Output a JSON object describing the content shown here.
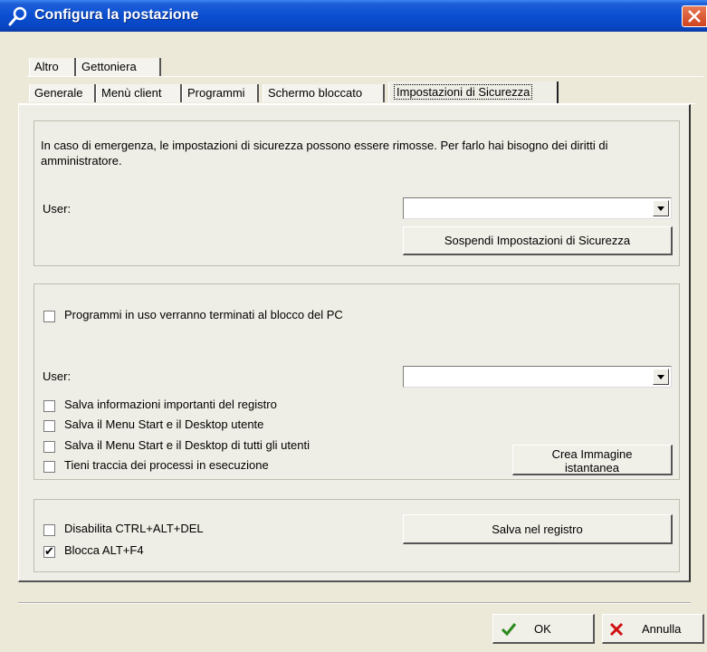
{
  "window": {
    "title": "Configura la postazione",
    "icon": "wrench-icon"
  },
  "tabs": {
    "row1": [
      "Altro",
      "Gettoniera"
    ],
    "row2": [
      "Generale",
      "Menù client",
      "Programmi",
      "Schermo bloccato",
      "Impostazioni di Sicurezza"
    ],
    "active": "Impostazioni di Sicurezza"
  },
  "emergency": {
    "description": "In caso di emergenza, le impostazioni di sicurezza possono essere rimosse. Per farlo hai bisogno dei diritti di amministratore.",
    "user_label": "User:",
    "user_value": "",
    "suspend_button": "Sospendi Impostazioni di Sicurezza"
  },
  "lock": {
    "terminate_label": "Programmi in uso verranno terminati al blocco del PC",
    "terminate_checked": false,
    "user_label": "User:",
    "user_value": "",
    "options": [
      {
        "label": "Salva informazioni importanti del registro",
        "checked": false
      },
      {
        "label": "Salva il Menu Start e il Desktop utente",
        "checked": false
      },
      {
        "label": "Salva il Menu Start e il Desktop di tutti gli utenti",
        "checked": false
      },
      {
        "label": "Tieni traccia dei processi in esecuzione",
        "checked": false
      }
    ],
    "snapshot_button_line1": "Crea Immagine",
    "snapshot_button_line2": "istantanea"
  },
  "keys": {
    "ctrl_alt_del_label": "Disabilita CTRL+ALT+DEL",
    "ctrl_alt_del_checked": false,
    "alt_f4_label": "Blocca ALT+F4",
    "alt_f4_checked": true,
    "save_button": "Salva nel registro"
  },
  "footer": {
    "ok_label": "OK",
    "ok_icon": "checkmark-icon",
    "cancel_label": "Annulla",
    "cancel_icon": "x-icon"
  },
  "colors": {
    "titlebar": "#0a4fd0",
    "ok_check": "#2a8a1a",
    "cancel_x": "#d01010"
  }
}
